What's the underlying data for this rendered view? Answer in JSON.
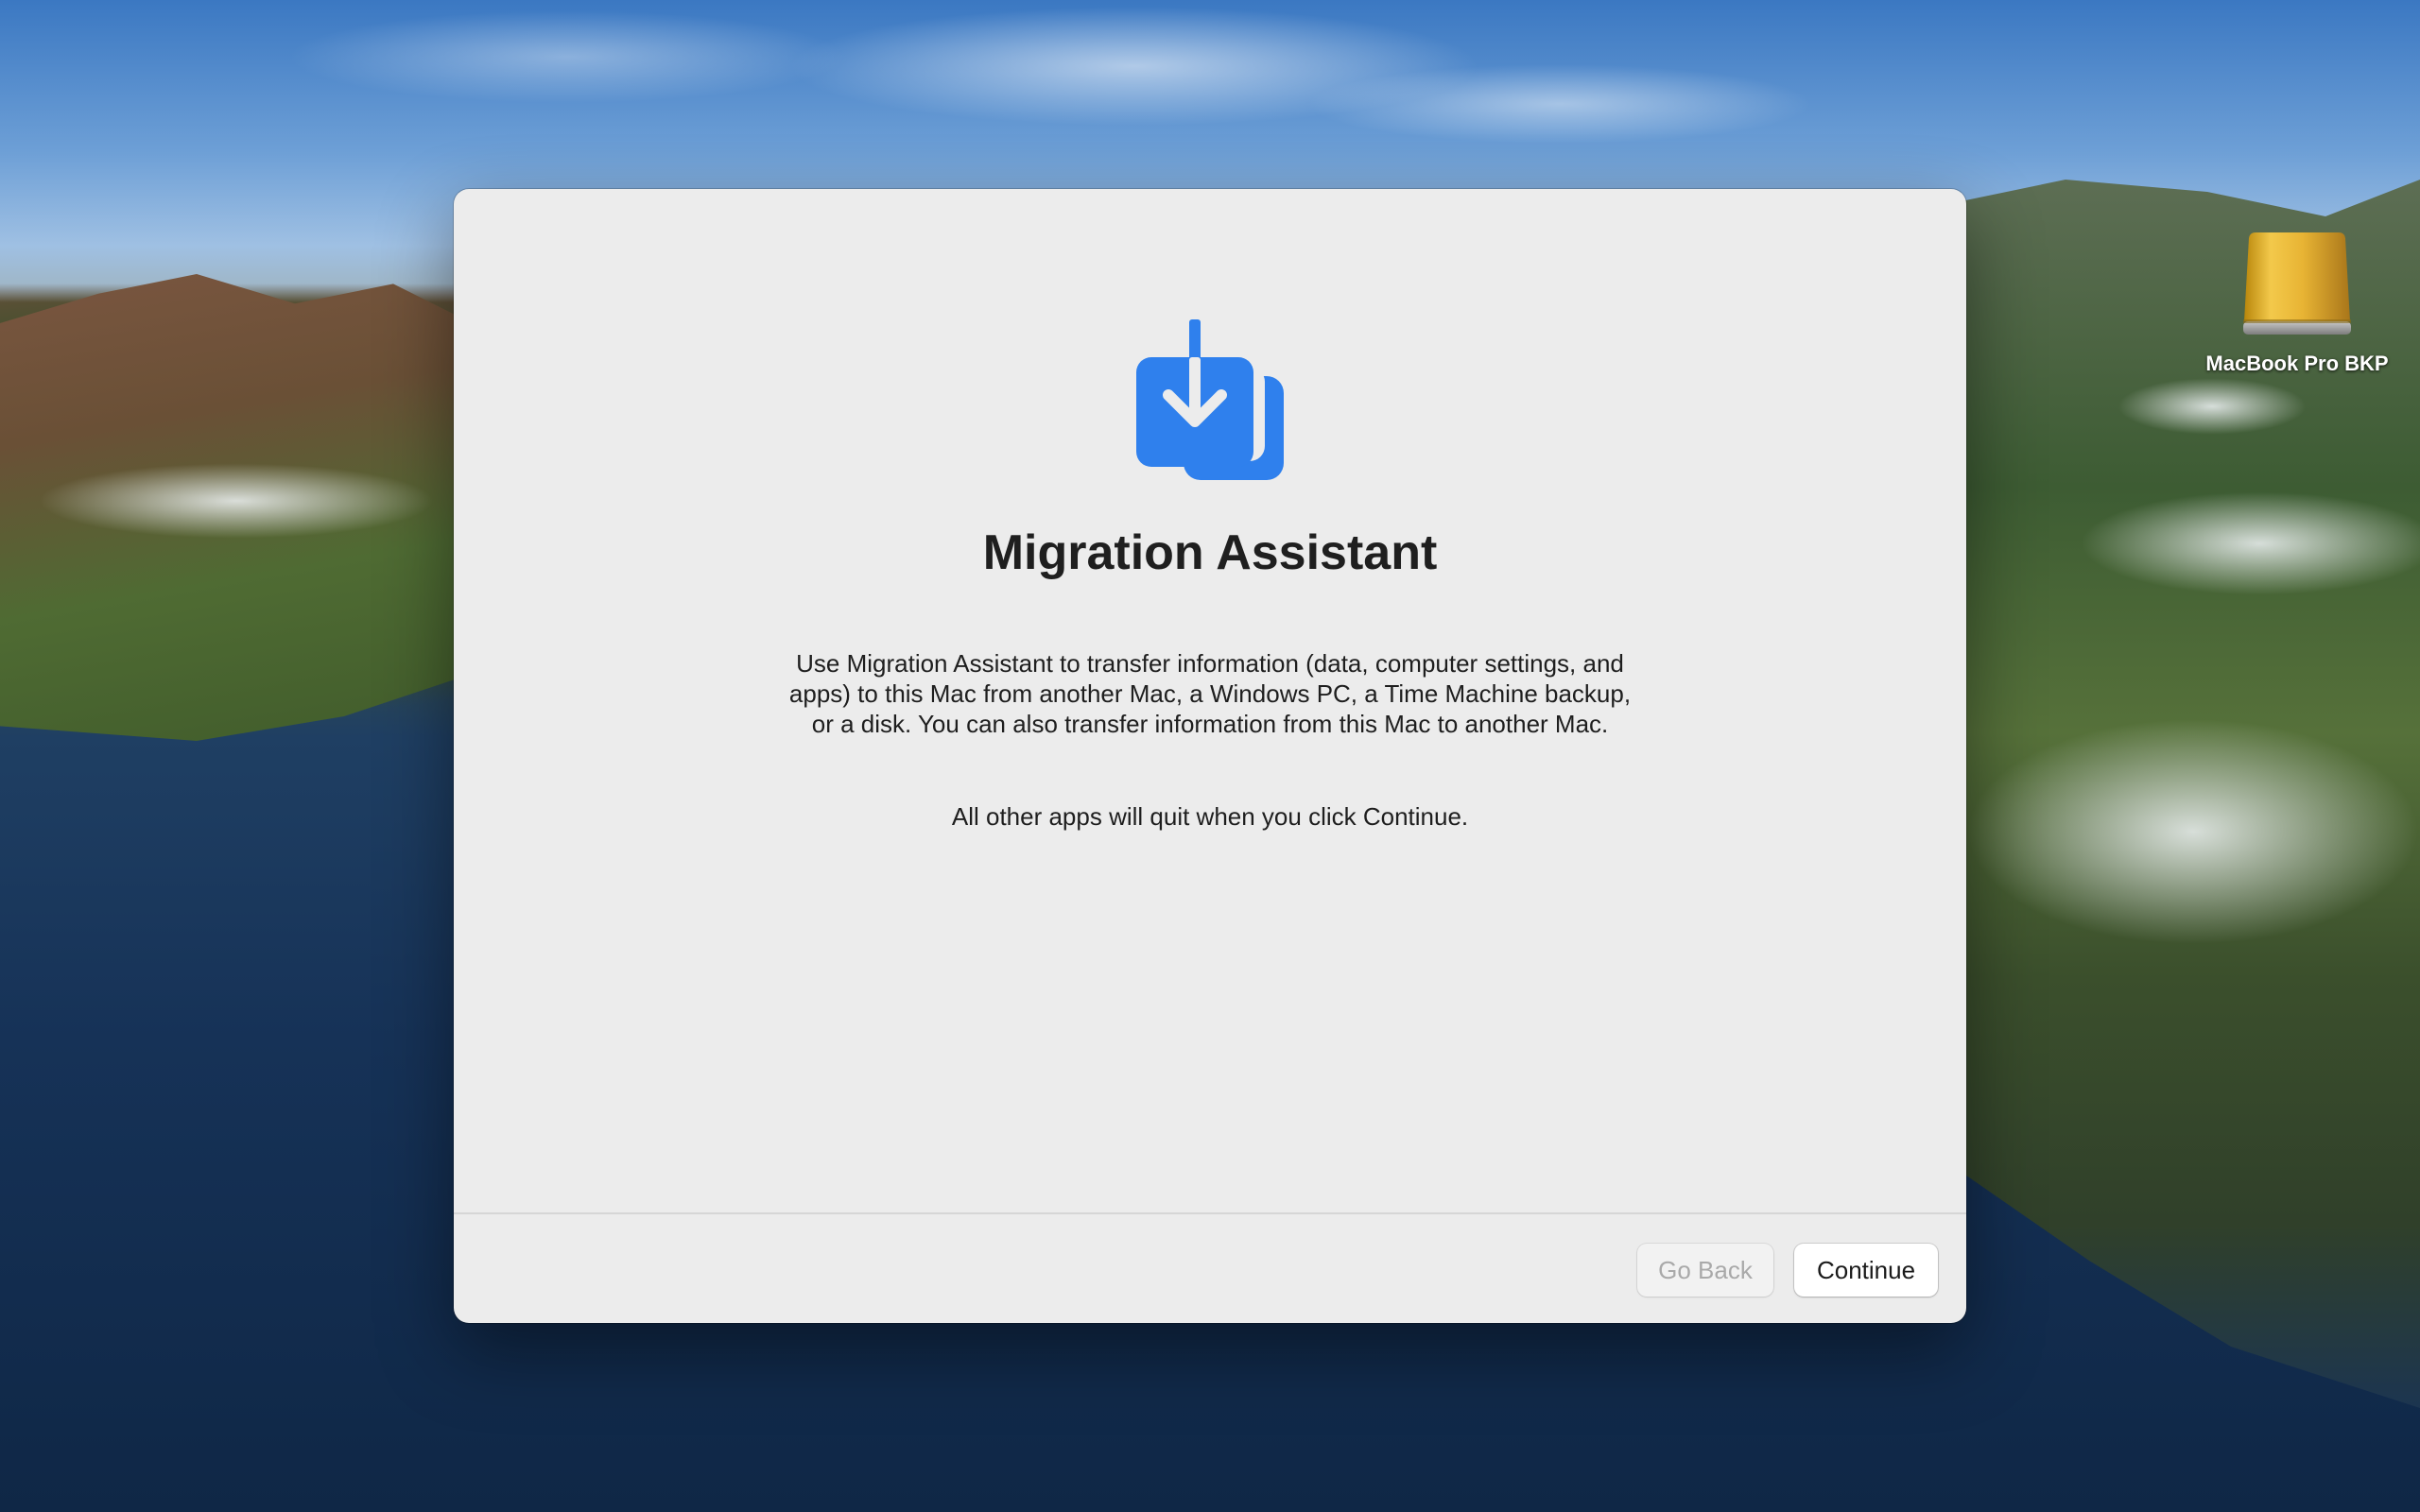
{
  "desktop": {
    "drive_label": "MacBook Pro BKP",
    "drive_icon": "external-drive-icon"
  },
  "window": {
    "app_icon": "migration-assistant-icon",
    "title": "Migration Assistant",
    "description": "Use Migration Assistant to transfer information (data, computer settings, and apps) to this Mac from another Mac, a Windows PC, a Time Machine backup, or a disk. You can also transfer information from this Mac to another Mac.",
    "note": "All other apps will quit when you click Continue.",
    "buttons": {
      "back_label": "Go Back",
      "continue_label": "Continue"
    }
  },
  "colors": {
    "accent": "#2f80ed",
    "window_bg": "#ececec",
    "drive_gold": "#e5b53a"
  }
}
